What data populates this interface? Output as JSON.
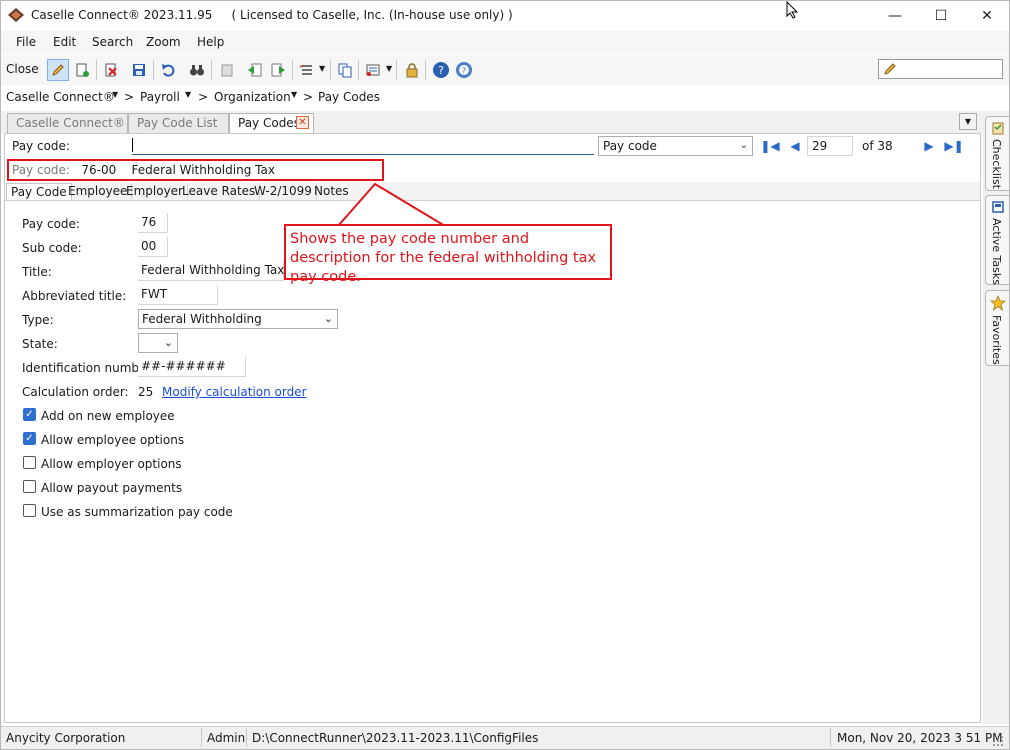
{
  "window": {
    "title": "Caselle Connect® 2023.11.95     ( Licensed to Caselle, Inc. (In-house use only) )"
  },
  "menu": [
    "File",
    "Edit",
    "Search",
    "Zoom",
    "Help"
  ],
  "toolbar": {
    "close_label": "Close",
    "icons": [
      "edit-pencil-icon",
      "new-record-icon",
      "delete-icon",
      "save-icon",
      "undo-icon",
      "find-binoculars-icon",
      "copy-doc-icon",
      "prev-doc-icon",
      "next-doc-icon",
      "list-options-icon",
      "duplicate-icon",
      "report-options-icon",
      "lock-icon",
      "help-icon",
      "whats-this-icon"
    ]
  },
  "breadcrumb": [
    "Caselle Connect®",
    "Payroll",
    "Organization",
    "Pay Codes"
  ],
  "tabs": [
    "Caselle Connect®",
    "Pay Code List",
    "Pay Codes"
  ],
  "record": {
    "label": "Pay code:",
    "lookup_by": "Pay code",
    "current": "29",
    "of_total": "of 38"
  },
  "info": {
    "label": "Pay code:",
    "code": "76-00",
    "description": "Federal Withholding Tax"
  },
  "sub_tabs": [
    "Pay Code",
    "Employee",
    "Employer",
    "Leave Rates",
    "W-2/1099",
    "Notes"
  ],
  "form": {
    "pay_code_label": "Pay code:",
    "pay_code": "76",
    "sub_code_label": "Sub code:",
    "sub_code": "00",
    "title_label": "Title:",
    "title": "Federal Withholding Tax",
    "abbrev_label": "Abbreviated title:",
    "abbrev": "FWT",
    "type_label": "Type:",
    "type": "Federal Withholding",
    "state_label": "State:",
    "state": "",
    "id_label": "Identification number:",
    "id_number": "##-######",
    "calc_label": "Calculation order:",
    "calc_order": "25",
    "calc_link": "Modify calculation order"
  },
  "checkboxes": [
    {
      "label": "Add on new employee",
      "checked": true
    },
    {
      "label": "Allow employee options",
      "checked": true
    },
    {
      "label": "Allow employer options",
      "checked": false
    },
    {
      "label": "Allow payout payments",
      "checked": false
    },
    {
      "label": "Use as summarization pay code",
      "checked": false
    }
  ],
  "callout": {
    "text": "Shows the pay code number and description for the federal withholding tax pay code."
  },
  "side_tabs": [
    "Checklist",
    "Active Tasks",
    "Favorites"
  ],
  "status": {
    "org": "Anycity Corporation",
    "user": "Admin",
    "path": "D:\\ConnectRunner\\2023.11-2023.11\\ConfigFiles",
    "datetime": "Mon, Nov 20, 2023 3 51 PM"
  },
  "colors": {
    "accent_red": "#e0141b",
    "link_blue": "#1a4fd6",
    "check_blue": "#2f6fd0",
    "nav_blue": "#2d69c6"
  }
}
